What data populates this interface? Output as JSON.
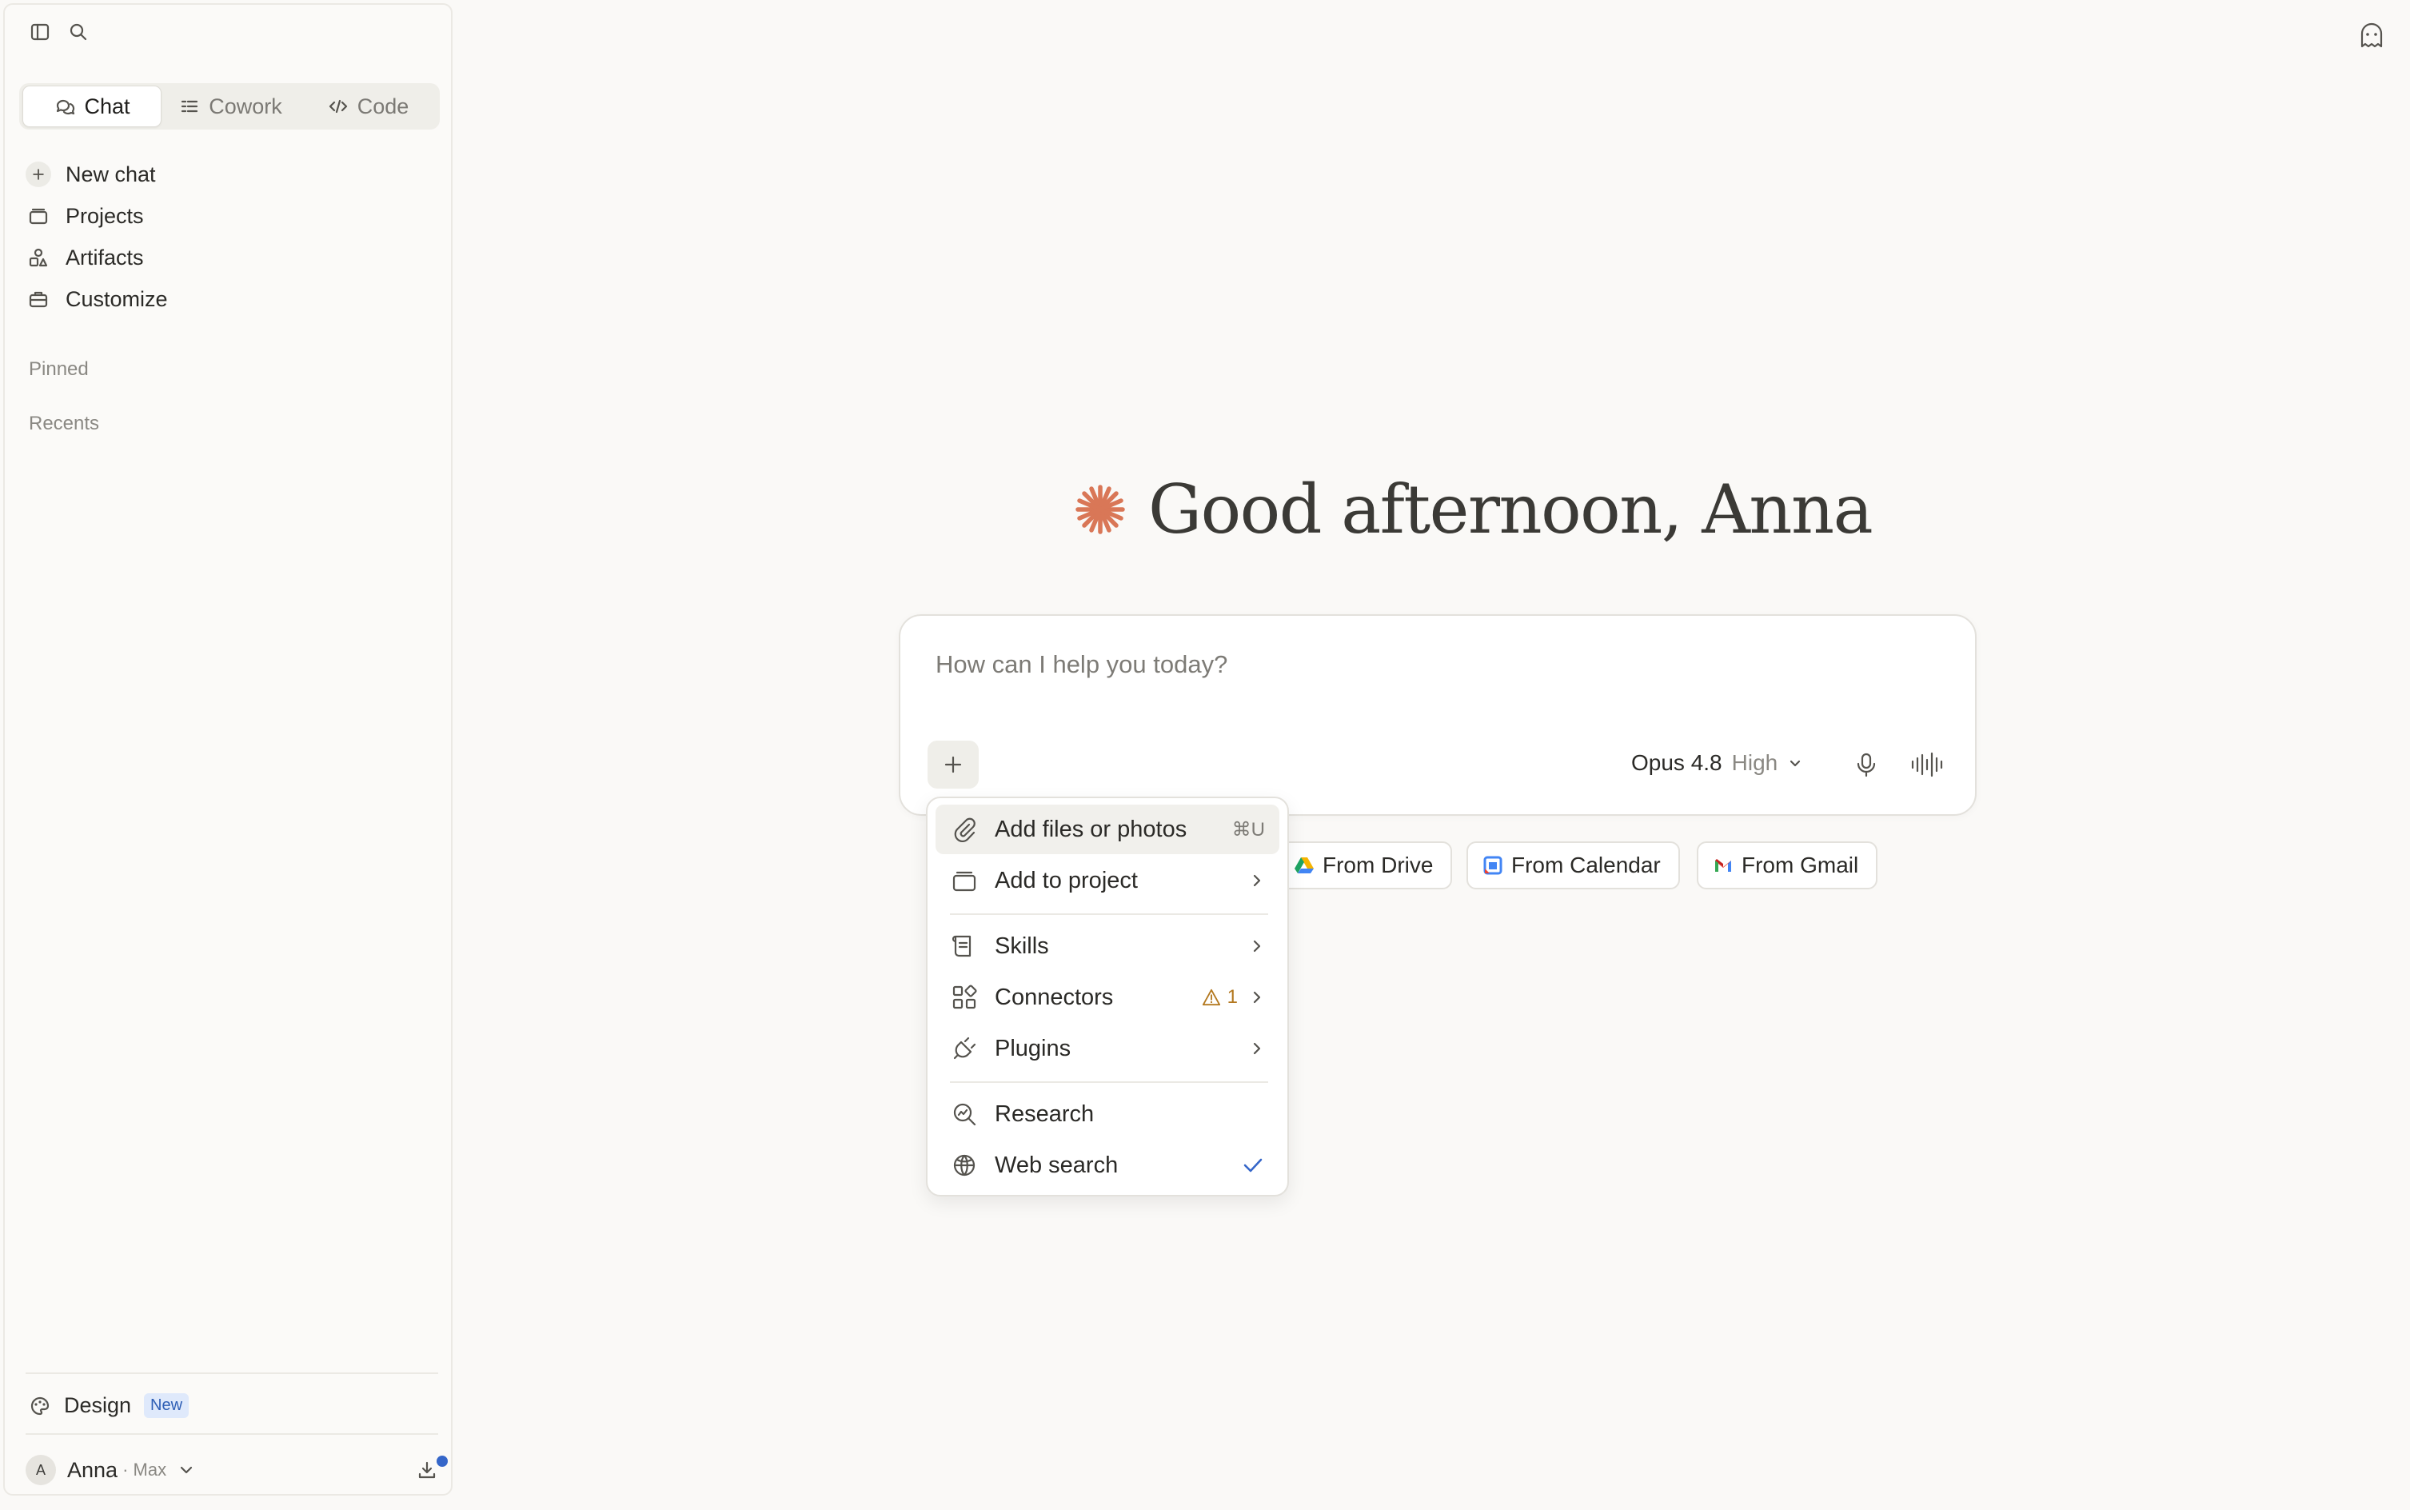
{
  "sidebar": {
    "tabs": [
      {
        "label": "Chat",
        "active": true
      },
      {
        "label": "Cowork"
      },
      {
        "label": "Code"
      }
    ],
    "nav": [
      {
        "label": "New chat",
        "icon": "plus-icon"
      },
      {
        "label": "Projects",
        "icon": "projects-icon"
      },
      {
        "label": "Artifacts",
        "icon": "artifacts-icon"
      },
      {
        "label": "Customize",
        "icon": "customize-icon"
      }
    ],
    "pinned_label": "Pinned",
    "recents_label": "Recents",
    "design": {
      "label": "Design",
      "badge": "New"
    },
    "user": {
      "initial": "A",
      "name": "Anna",
      "plan": "· Max"
    }
  },
  "main": {
    "greeting": "Good afternoon, Anna",
    "composer": {
      "placeholder": "How can I help you today?",
      "model": "Opus 4.8",
      "effort": "High"
    },
    "chips": [
      {
        "label": "From Drive",
        "icon": "google-drive-icon"
      },
      {
        "label": "From Calendar",
        "icon": "google-calendar-icon"
      },
      {
        "label": "From Gmail",
        "icon": "gmail-icon"
      }
    ]
  },
  "menu": {
    "items": [
      {
        "label": "Add files or photos",
        "shortcut": "⌘U",
        "icon": "paperclip-icon"
      },
      {
        "label": "Add to project",
        "icon": "projects-icon",
        "submenu": true
      },
      {
        "label": "Skills",
        "icon": "skills-icon",
        "submenu": true
      },
      {
        "label": "Connectors",
        "icon": "connectors-icon",
        "warning_count": "1",
        "submenu": true
      },
      {
        "label": "Plugins",
        "icon": "plugin-icon",
        "submenu": true
      },
      {
        "label": "Research",
        "icon": "research-icon"
      },
      {
        "label": "Web search",
        "icon": "globe-icon",
        "checked": true
      }
    ]
  },
  "colors": {
    "accent": "#d97757",
    "background": "#faf9f7",
    "check": "#3566c9",
    "warning": "#b3781f"
  }
}
